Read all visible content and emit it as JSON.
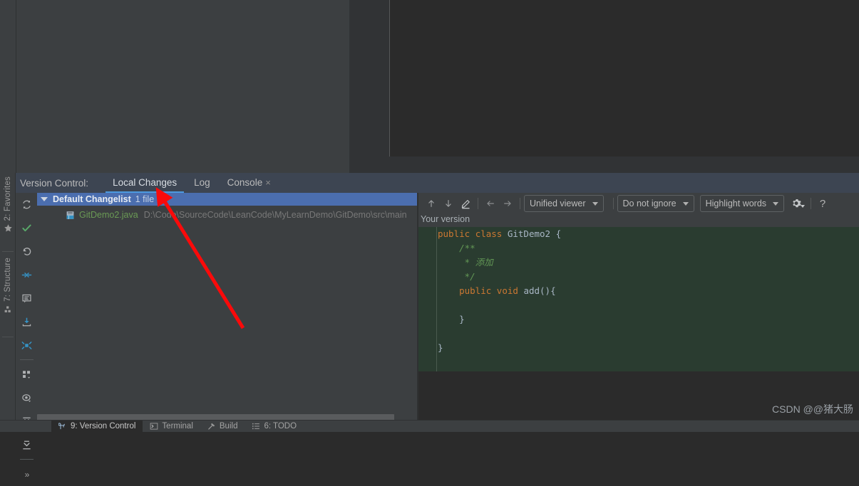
{
  "window": {
    "tool_window_title": "Version Control:",
    "tabs": [
      {
        "label": "Local Changes",
        "active": true,
        "closable": false
      },
      {
        "label": "Log",
        "active": false,
        "closable": false
      },
      {
        "label": "Console",
        "active": false,
        "closable": true
      }
    ],
    "tab_close_glyph": "×"
  },
  "changes": {
    "rail_icons": [
      "refresh-icon",
      "commit-check-icon",
      "rollback-icon",
      "shelve-icon",
      "show-diff-icon",
      "get-from-vcs-icon",
      "unshelve-icon",
      "group-by-icon",
      "preview-eye-icon",
      "expand-all-icon",
      "collapse-all-icon",
      "more-chevron-icon"
    ],
    "changelist": {
      "name": "Default Changelist",
      "count_label": "1 file",
      "expanded": true
    },
    "files": [
      {
        "name": "GitDemo2.java",
        "path": "D:\\Code\\SourceCode\\LeanCode\\MyLearnDemo\\GitDemo\\src\\main",
        "status_color": "#6a9a55"
      }
    ]
  },
  "diff": {
    "toolbar": {
      "prev_change_icon": "arrow-up-icon",
      "next_change_icon": "arrow-down-icon",
      "annotate_icon": "pencil-icon",
      "back_icon": "arrow-left-icon",
      "forward_icon": "arrow-right-icon",
      "viewer_mode": "Unified viewer",
      "ignore_mode": "Do not ignore",
      "highlight_mode": "Highlight words",
      "settings_icon": "gear-icon",
      "help_label": "?"
    },
    "pane_label": "Your version",
    "code_lines": [
      [
        {
          "t": "public ",
          "c": "kw"
        },
        {
          "t": "class ",
          "c": "kw"
        },
        {
          "t": "GitDemo2",
          "c": "cls"
        },
        {
          "t": " {",
          "c": "pl"
        }
      ],
      [
        {
          "t": "    /**",
          "c": "cmt"
        }
      ],
      [
        {
          "t": "     * 添加",
          "c": "cmt"
        }
      ],
      [
        {
          "t": "     */",
          "c": "cmt"
        }
      ],
      [
        {
          "t": "    public ",
          "c": "kw"
        },
        {
          "t": "void ",
          "c": "kw"
        },
        {
          "t": "add",
          "c": "mtd"
        },
        {
          "t": "(){",
          "c": "pl"
        }
      ],
      [
        {
          "t": "",
          "c": "pl"
        }
      ],
      [
        {
          "t": "    }",
          "c": "pl"
        }
      ],
      [
        {
          "t": "",
          "c": "pl"
        }
      ],
      [
        {
          "t": "}",
          "c": "pl"
        }
      ]
    ]
  },
  "left_bar": {
    "items": [
      {
        "label": "2: Favorites",
        "icon": "star-icon"
      },
      {
        "label": "7: Structure",
        "icon": "structure-icon"
      }
    ]
  },
  "statusbar": {
    "items": [
      {
        "label": "9: Version Control",
        "icon": "vcs-icon",
        "active": true
      },
      {
        "label": "Terminal",
        "icon": "terminal-icon",
        "active": false
      },
      {
        "label": "Build",
        "icon": "hammer-icon",
        "active": false
      },
      {
        "label": "6: TODO",
        "icon": "todo-icon",
        "active": false
      }
    ]
  },
  "watermark": {
    "text": "CSDN @@猪大肠"
  },
  "colors": {
    "accent_blue": "#4d9ae0",
    "selection_blue": "#4b6eaf",
    "diff_green_bg": "#2a3c30",
    "panel_bg": "#3c3f41",
    "editor_bg": "#2b2b2b",
    "annotation_red": "#fa0a0a"
  }
}
